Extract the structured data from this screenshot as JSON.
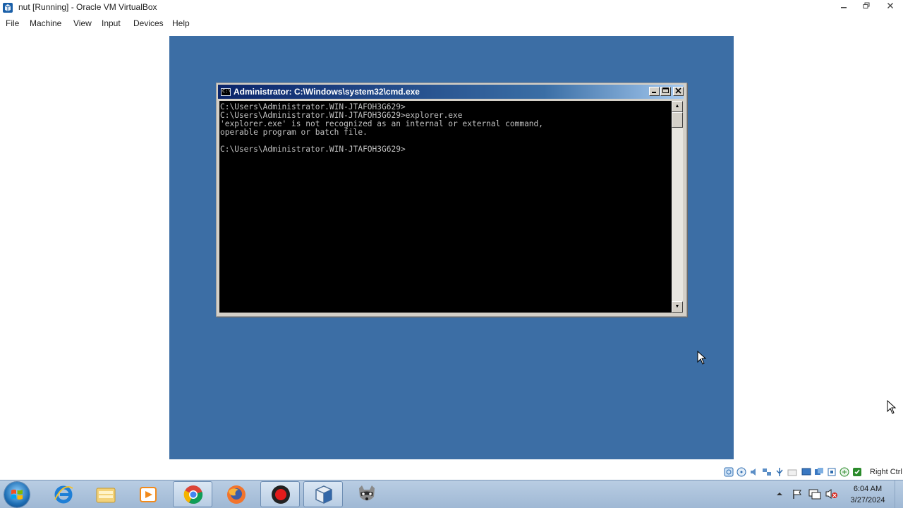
{
  "host_window": {
    "title": "nut [Running] - Oracle VM VirtualBox",
    "controls": {
      "minimize": "minimize",
      "restore": "restore",
      "close": "close"
    }
  },
  "menubar": {
    "items": [
      "File",
      "Machine",
      "View",
      "Input",
      "Devices",
      "Help"
    ]
  },
  "guest": {
    "desktop_color": "#3c6ea5",
    "cmd_window": {
      "title": "Administrator: C:\\Windows\\system32\\cmd.exe",
      "console_lines": [
        "C:\\Users\\Administrator.WIN-JTAFOH3G629>",
        "C:\\Users\\Administrator.WIN-JTAFOH3G629>explorer.exe",
        "'explorer.exe' is not recognized as an internal or external command,",
        "operable program or batch file.",
        "",
        "C:\\Users\\Administrator.WIN-JTAFOH3G629>"
      ]
    }
  },
  "vbox_statusbar": {
    "icons": [
      "hard-disk-icon",
      "optical-drive-icon",
      "audio-icon",
      "network-icon",
      "usb-icon",
      "shared-folders-icon",
      "display-icon",
      "video-capture-icon",
      "cpu-icon",
      "mouse-integration-icon",
      "keyboard-icon"
    ],
    "host_key_label": "Right Ctrl"
  },
  "taskbar": {
    "pinned": [
      "internet-explorer-icon",
      "file-explorer-icon",
      "media-player-icon",
      "chrome-icon",
      "firefox-icon",
      "record-icon",
      "virtualbox-icon",
      "raccoon-app-icon"
    ],
    "tray_icons": [
      "show-hidden-icons-icon",
      "action-center-flag-icon",
      "network-icon",
      "volume-muted-icon"
    ],
    "clock_time": "6:04 AM",
    "clock_date": "3/27/2024"
  }
}
